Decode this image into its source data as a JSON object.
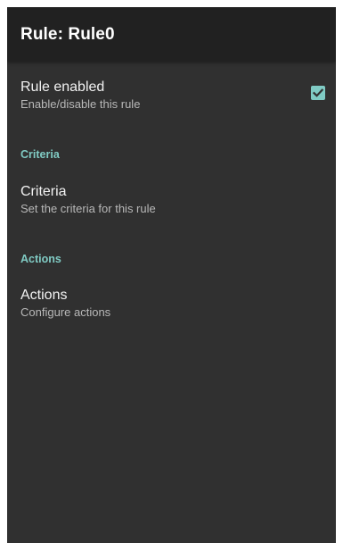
{
  "app_bar": {
    "title": "Rule: Rule0"
  },
  "rule_enabled": {
    "title": "Rule enabled",
    "summary": "Enable/disable this rule",
    "checked": true,
    "accent_color": "#80cbc4"
  },
  "criteria_section": {
    "header": "Criteria",
    "item": {
      "title": "Criteria",
      "summary": "Set the criteria for this rule"
    }
  },
  "actions_section": {
    "header": "Actions",
    "item": {
      "title": "Actions",
      "summary": "Configure actions"
    }
  },
  "icons": {
    "checkbox": "checkmark-icon"
  }
}
